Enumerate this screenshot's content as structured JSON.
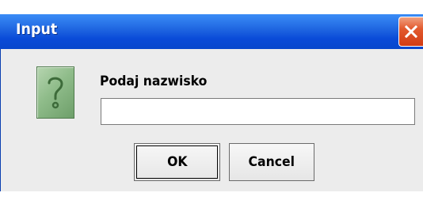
{
  "dialog": {
    "title": "Input",
    "prompt": "Podaj nazwisko",
    "input_value": ""
  },
  "buttons": {
    "ok_label": "OK",
    "cancel_label": "Cancel"
  },
  "icons": {
    "dialog_icon": "question-icon",
    "close_icon": "close-icon"
  },
  "colors": {
    "titlebar": "#0a4bd8",
    "close_button": "#d23c14",
    "panel_background": "#ececec",
    "question_icon": "#8fbc8a"
  }
}
